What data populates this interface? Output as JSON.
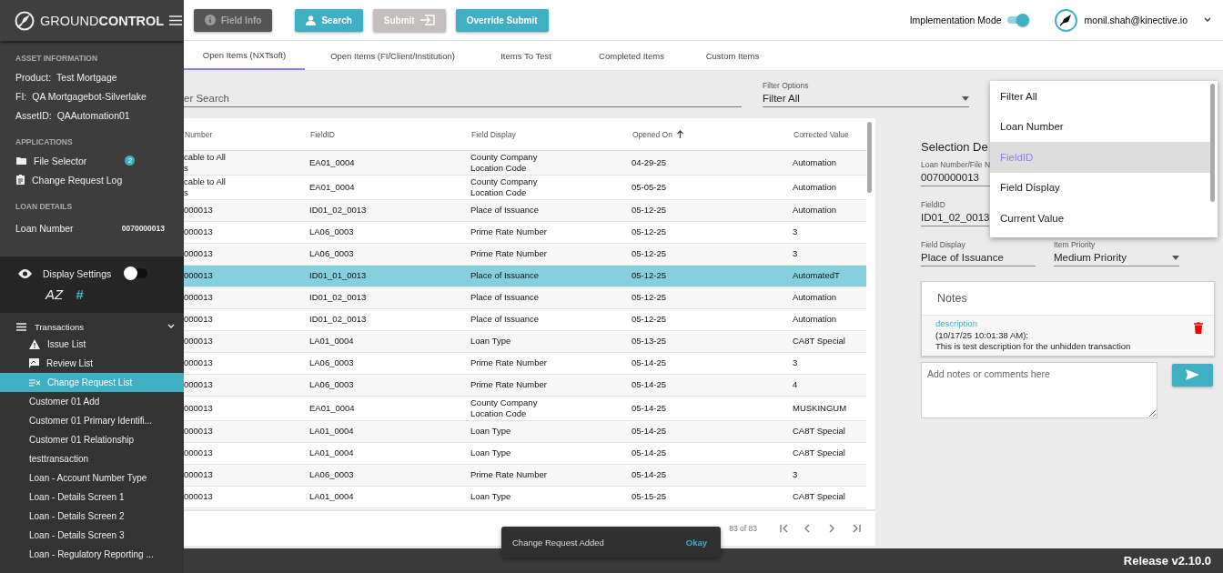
{
  "sidebar": {
    "logo": "GROUND**CONTROL**",
    "asset_information": {
      "heading": "ASSET INFORMATION",
      "fields": [
        {
          "label": "Product:",
          "value": "Test Mortgage"
        },
        {
          "label": "FI:",
          "value": "QA Mortgagebot-Silverlake"
        },
        {
          "label": "AssetID:",
          "value": "QAAutomation01"
        }
      ]
    },
    "applications": {
      "heading": "APPLICATIONS",
      "items": [
        {
          "label": "File Selector",
          "kind": "folder",
          "badge": "2"
        },
        {
          "label": "Change Request Log",
          "kind": "clipboard"
        }
      ]
    },
    "loan_details": {
      "heading": "LOAN DETAILS",
      "label": "Loan Number",
      "value": "0070000013"
    },
    "display_settings": {
      "label": "Display Settings",
      "on": false,
      "modes": [
        {
          "label": "AZ",
          "selected": false
        },
        {
          "label": "#",
          "selected": true
        }
      ]
    },
    "transactions": {
      "label": "Transactions",
      "expanded": true,
      "items": [
        {
          "label": "Issue List",
          "kind": "warning",
          "selected": false
        },
        {
          "label": "Review List",
          "kind": "review",
          "selected": false
        },
        {
          "label": "Change Request List",
          "kind": "change",
          "selected": true
        },
        {
          "label": "Customer 01 Add",
          "kind": "plain",
          "selected": false
        },
        {
          "label": "Customer 01 Primary Identifi...",
          "kind": "plain",
          "selected": false
        },
        {
          "label": "Customer 01 Relationship",
          "kind": "plain",
          "selected": false
        },
        {
          "label": "testtransaction",
          "kind": "plain",
          "selected": false
        },
        {
          "label": "Loan - Account Number Type",
          "kind": "plain",
          "selected": false
        },
        {
          "label": "Loan - Details Screen 1",
          "kind": "plain",
          "selected": false
        },
        {
          "label": "Loan - Details Screen 2",
          "kind": "plain",
          "selected": false
        },
        {
          "label": "Loan - Details Screen 3",
          "kind": "plain",
          "selected": false
        },
        {
          "label": "Loan - Regulatory Reporting ...",
          "kind": "plain",
          "selected": false
        }
      ]
    }
  },
  "toolbar": {
    "buttons": [
      {
        "label": "Field Info",
        "kind": "info"
      },
      {
        "label": "Search",
        "kind": "person"
      },
      {
        "label": "Submit",
        "kind": "submit"
      },
      {
        "label": "Override Submit",
        "kind": "plain"
      }
    ],
    "implementation_mode": {
      "label": "Implementation Mode",
      "on": true
    },
    "user": {
      "email": "monil.shah@kinective.io"
    }
  },
  "tabs": [
    {
      "label": "Open Items (NXTsoft)",
      "selected": true
    },
    {
      "label": "Open Items (FI/Client/Institution)",
      "selected": false
    },
    {
      "label": "Items To Test",
      "selected": false
    },
    {
      "label": "Completed Items",
      "selected": false
    },
    {
      "label": "Custom Items",
      "selected": false
    }
  ],
  "filter_bar": {
    "search": {
      "placeholder": "er Search"
    },
    "filter_options": {
      "label": "Filter Options",
      "value": "Filter All"
    }
  },
  "dropdown": {
    "options": [
      {
        "label": "Filter All",
        "selected": false
      },
      {
        "label": "Loan Number",
        "selected": false
      },
      {
        "label": "FieldID",
        "selected": true
      },
      {
        "label": "Field Display",
        "selected": false
      },
      {
        "label": "Current Value",
        "selected": false
      }
    ]
  },
  "table": {
    "columns": [
      {
        "label": "Number",
        "sorted": false
      },
      {
        "label": "FieldID",
        "sorted": false
      },
      {
        "label": "Field Display",
        "sorted": false
      },
      {
        "label": "Opened On",
        "sorted": true
      },
      {
        "label": "Corrected Value",
        "sorted": false
      }
    ],
    "rows": [
      {
        "cells": [
          "cable to All\ns",
          "EA01_0004",
          "County Company\nLocation Code",
          "04-29-25",
          "Automation"
        ],
        "selected": false
      },
      {
        "cells": [
          "cable to All\ns",
          "EA01_0004",
          "County Company\nLocation Code",
          "05-05-25",
          "Automation"
        ],
        "selected": false
      },
      {
        "cells": [
          "000013",
          "ID01_02_0013",
          "Place of Issuance",
          "05-12-25",
          "Automation"
        ],
        "selected": false
      },
      {
        "cells": [
          "000013",
          "LA06_0003",
          "Prime Rate Number",
          "05-12-25",
          "3"
        ],
        "selected": false
      },
      {
        "cells": [
          "000013",
          "LA06_0003",
          "Prime Rate Number",
          "05-12-25",
          "3"
        ],
        "selected": false
      },
      {
        "cells": [
          "000013",
          "ID01_01_0013",
          "Place of Issuance",
          "05-12-25",
          "AutomatedT"
        ],
        "selected": true
      },
      {
        "cells": [
          "000013",
          "ID01_02_0013",
          "Place of Issuance",
          "05-12-25",
          "Automation"
        ],
        "selected": false
      },
      {
        "cells": [
          "000013",
          "ID01_02_0013",
          "Place of Issuance",
          "05-12-25",
          "Automation"
        ],
        "selected": false
      },
      {
        "cells": [
          "000013",
          "LA01_0004",
          "Loan Type",
          "05-13-25",
          "CA8T Special"
        ],
        "selected": false
      },
      {
        "cells": [
          "000013",
          "LA06_0003",
          "Prime Rate Number",
          "05-14-25",
          "3"
        ],
        "selected": false
      },
      {
        "cells": [
          "000013",
          "LA06_0003",
          "Prime Rate Number",
          "05-14-25",
          "4"
        ],
        "selected": false
      },
      {
        "cells": [
          "000013",
          "EA01_0004",
          "County Company\nLocation Code",
          "05-14-25",
          "MUSKINGUM"
        ],
        "selected": false
      },
      {
        "cells": [
          "000013",
          "LA01_0004",
          "Loan Type",
          "05-14-25",
          "CA8T Special"
        ],
        "selected": false
      },
      {
        "cells": [
          "000013",
          "LA01_0004",
          "Loan Type",
          "05-14-25",
          "CA8T Special"
        ],
        "selected": false
      },
      {
        "cells": [
          "000013",
          "LA06_0003",
          "Prime Rate Number",
          "05-14-25",
          "3"
        ],
        "selected": false
      },
      {
        "cells": [
          "000013",
          "LA01_0004",
          "Loan Type",
          "05-15-25",
          "CA8T Special"
        ],
        "selected": false
      }
    ]
  },
  "paginator": {
    "range": "83 of 83"
  },
  "selection_details": {
    "title": "Selection De",
    "fields": [
      {
        "label": "Loan Number/File N",
        "value": "0070000013",
        "kind": "text"
      },
      {
        "label": "FieldID",
        "value": "ID01_02_0013",
        "kind": "text"
      },
      {
        "label": "Field Display",
        "value": "Place of Issuance",
        "kind": "text"
      },
      {
        "label": "Item Priority",
        "value": "Medium Priority",
        "kind": "select"
      }
    ]
  },
  "notes": {
    "title": "Notes",
    "entries": [
      {
        "author": "description",
        "time": "(10/17/25 10:01:38 AM):",
        "text": "This is test description for the unhidden transaction"
      }
    ],
    "placeholder": "Add notes or comments here"
  },
  "snackbar": {
    "message": "Change Request Added",
    "action": "Okay"
  },
  "footer": {
    "release": "Release v2.10.0"
  }
}
